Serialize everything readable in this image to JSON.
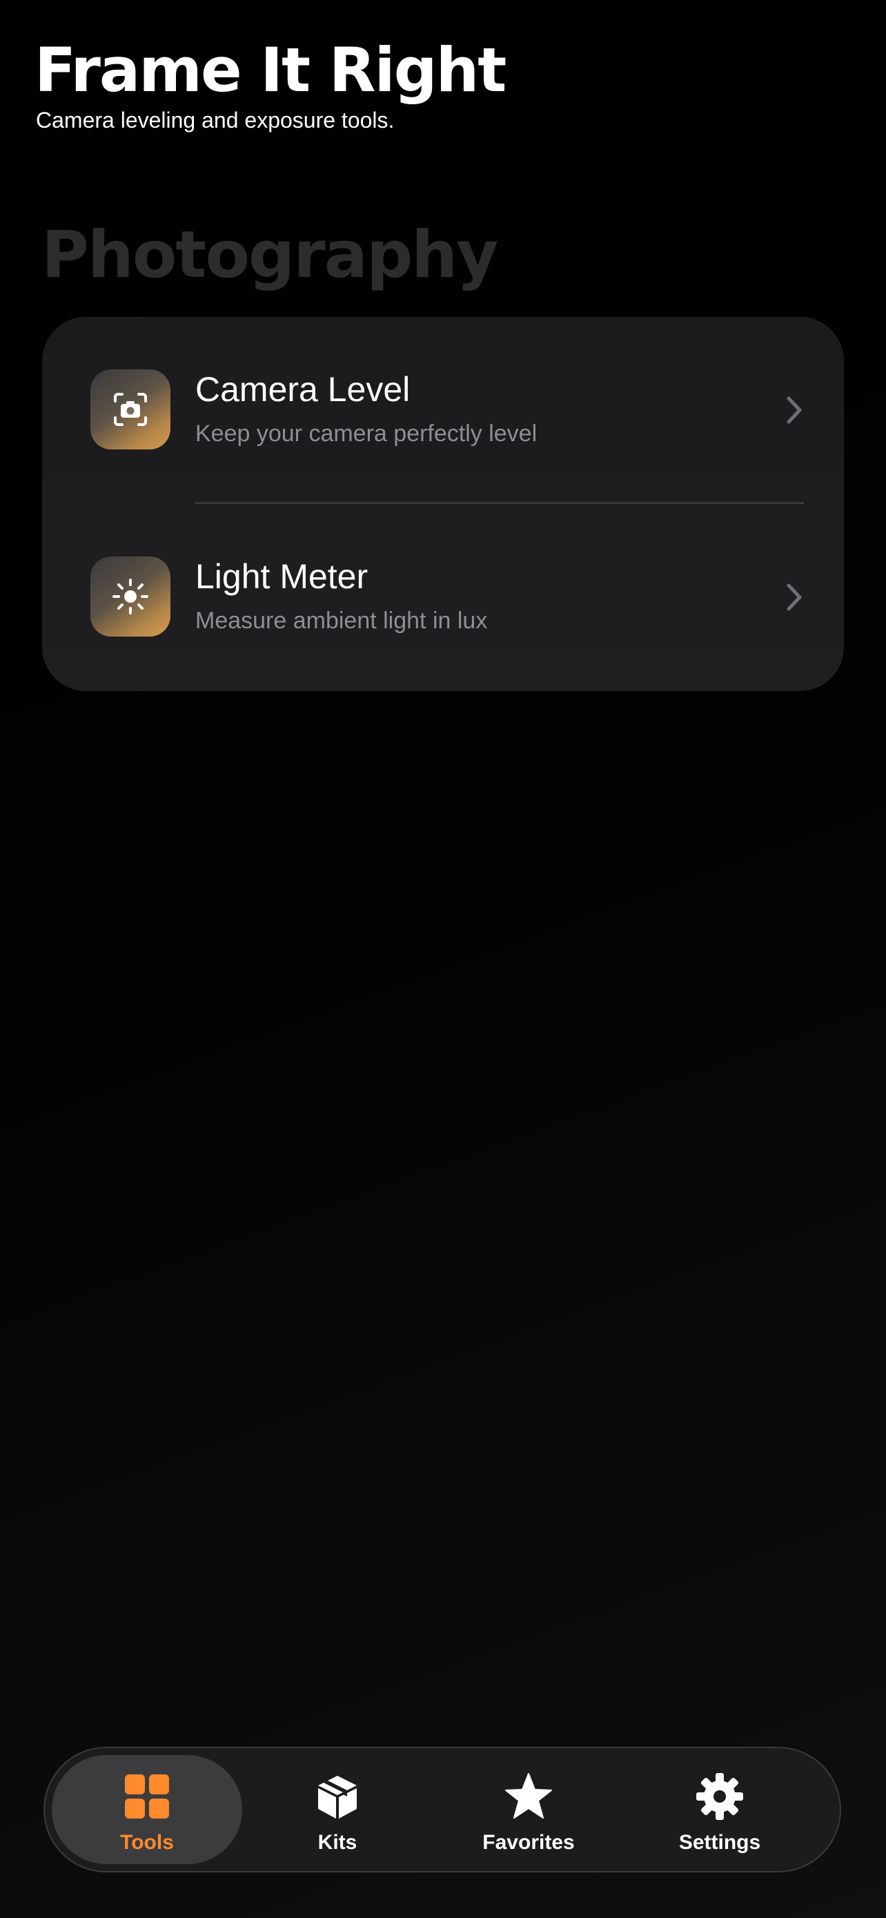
{
  "header": {
    "title": "Frame It Right",
    "subtitle": "Camera leveling and exposure tools."
  },
  "section": {
    "title": "Photography"
  },
  "tools": [
    {
      "name": "Camera Level",
      "description": "Keep your camera perfectly level",
      "icon": "camera-viewfinder-icon"
    },
    {
      "name": "Light Meter",
      "description": "Measure ambient light in lux",
      "icon": "sun-icon"
    }
  ],
  "tab_bar": {
    "tabs": [
      {
        "label": "Tools",
        "icon": "grid-icon",
        "active": true
      },
      {
        "label": "Kits",
        "icon": "box-icon",
        "active": false
      },
      {
        "label": "Favorites",
        "icon": "star-icon",
        "active": false
      },
      {
        "label": "Settings",
        "icon": "gear-icon",
        "active": false
      }
    ]
  },
  "colors": {
    "accent": "#ff8a2c",
    "background": "#000000",
    "card": "#1c1c1e",
    "secondary_text": "#8e8e93"
  }
}
